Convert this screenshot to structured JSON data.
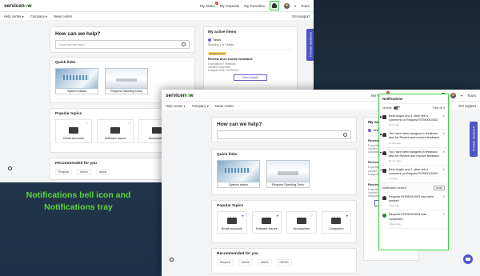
{
  "brand": {
    "logo_prefix": "servicen",
    "logo_o": "o",
    "logo_suffix": "w"
  },
  "top_links": {
    "my_tasks": "My Tasks",
    "my_tasks_badge": "4",
    "my_requests": "My requests",
    "my_favorites": "My Favorites",
    "user": "Tours"
  },
  "nav": {
    "help_center": "Help center ▾",
    "company": "Company ▾",
    "news_center": "News center",
    "get_support": "Get support"
  },
  "hero": {
    "title": "How can we help?",
    "search_placeholder": "How can we help?"
  },
  "quick_links": {
    "title": "Quick links",
    "items": [
      "System status",
      "Request Standing Desk"
    ]
  },
  "popular_topics": {
    "title": "Popular topics",
    "items": [
      "Email accounts",
      "Software issues",
      "Accessories",
      "Computers"
    ]
  },
  "recommended": {
    "title": "Recommended for you",
    "items": [
      "Request",
      "Article",
      "Article",
      "HR/HR"
    ]
  },
  "active_items": {
    "title": "My active items",
    "tab": "Tasks",
    "showing": "Showing 1 of 1 tasks",
    "tag": "Request Form",
    "item_title": "Review and resolve feedback",
    "item_meta": "Expectations / Feedback\nLandline Equipment\nAssigned Date: 10/20/2022",
    "view_details": "View details"
  },
  "feedback_tab": "Provide feedback",
  "tray": {
    "title": "Notifications",
    "unread_label": "Unread",
    "filter_label": "Filter by ▾",
    "notifications": [
      {
        "icon": "chat",
        "text": "Beth Anglin and 1 other left a comment on Request RITM0010003",
        "time": "5 min ago"
      },
      {
        "icon": "bell",
        "text": "You have been assigned a feedback task for Review and resolve feedback",
        "time": "10 min ago"
      },
      {
        "icon": "bell",
        "text": "You have been assigned a feedback task for Review and resolve feedback",
        "time": "20 min ago"
      },
      {
        "icon": "chat",
        "text": "Beth Anglin and 1 other left a comment on Request RITM0010003",
        "time": "1 hr ago"
      }
    ],
    "cleared_label": "Notification cleared",
    "undo_label": "Undo",
    "older": [
      {
        "icon": "bell",
        "text": "Request RITM0010003 has been created",
        "time": "1 day ago"
      },
      {
        "icon": "check",
        "text": "Request RITM0010003 was completed",
        "time": "2 days ago"
      }
    ]
  },
  "caption": {
    "line1": "Notifications bell icon and",
    "line2": "Notifications tray"
  },
  "colors": {
    "highlight": "#3ecf3e",
    "brand_purple": "#4d55c4",
    "caption_green": "#5fd63b"
  }
}
